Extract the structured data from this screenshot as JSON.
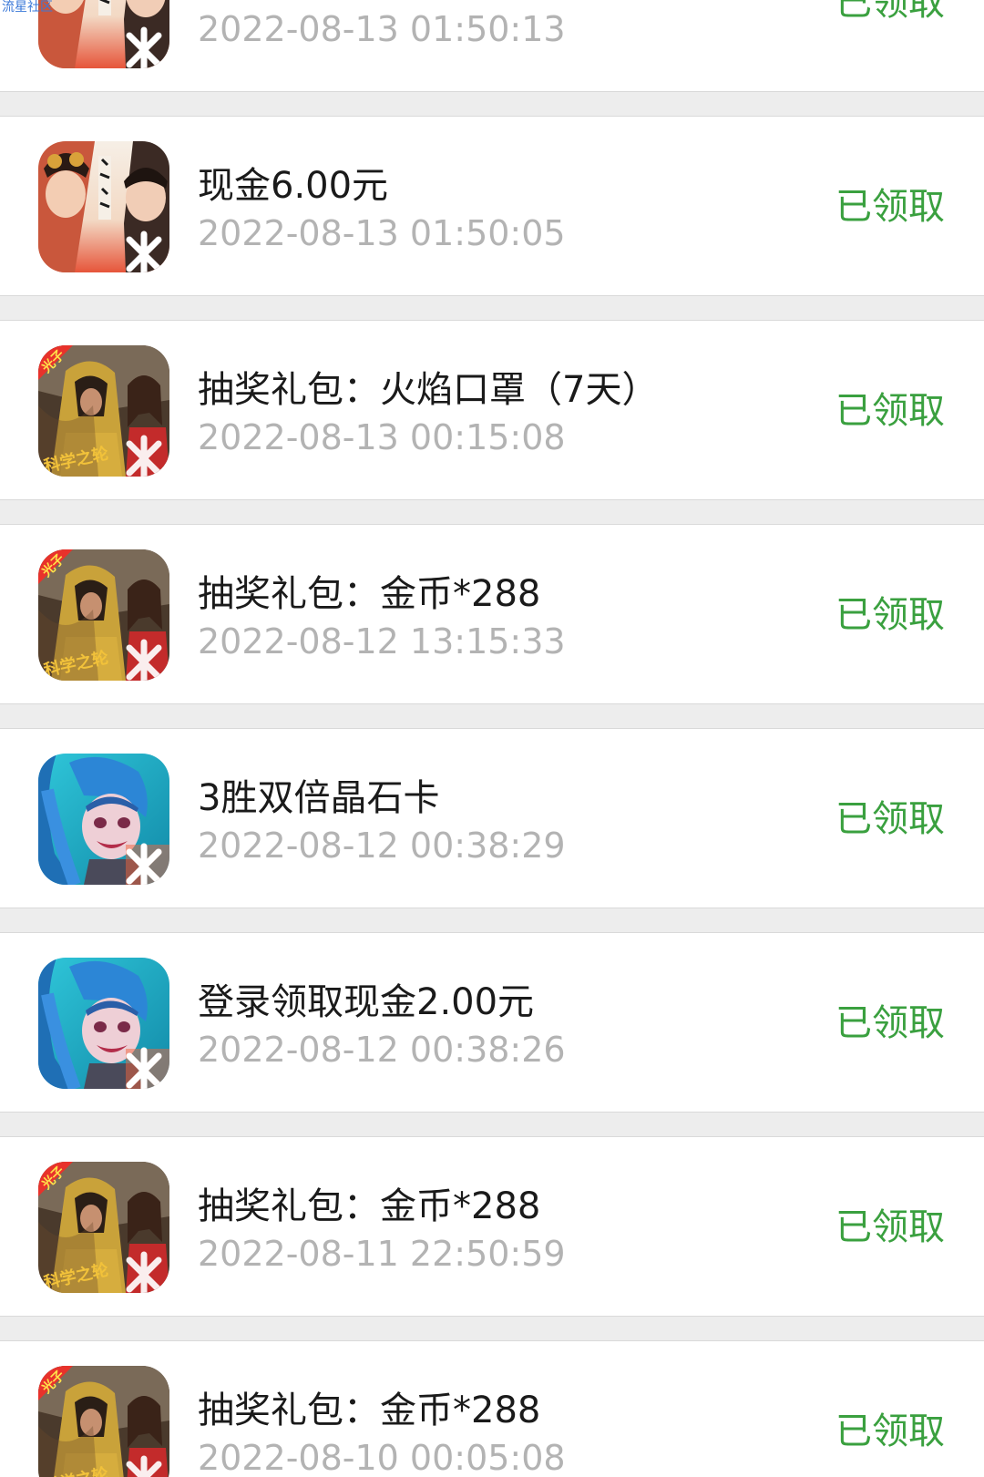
{
  "watermark": "流星社区",
  "records": [
    {
      "title": "",
      "time": "2022-08-13 01:50:13",
      "status": "已领取",
      "game_icon": "drama-game-icon"
    },
    {
      "title": "现金6.00元",
      "time": "2022-08-13 01:50:05",
      "status": "已领取",
      "game_icon": "drama-game-icon"
    },
    {
      "title": "抽奖礼包：火焰口罩（7天）",
      "time": "2022-08-13 00:15:08",
      "status": "已领取",
      "game_icon": "battle-game-icon",
      "icon_badge": "光子",
      "icon_caption": "科学之轮"
    },
    {
      "title": "抽奖礼包：金币*288",
      "time": "2022-08-12 13:15:33",
      "status": "已领取",
      "game_icon": "battle-game-icon",
      "icon_badge": "光子",
      "icon_caption": "科学之轮"
    },
    {
      "title": "3胜双倍晶石卡",
      "time": "2022-08-12 00:38:29",
      "status": "已领取",
      "game_icon": "hero-game-icon"
    },
    {
      "title": "登录领取现金2.00元",
      "time": "2022-08-12 00:38:26",
      "status": "已领取",
      "game_icon": "hero-game-icon"
    },
    {
      "title": "抽奖礼包：金币*288",
      "time": "2022-08-11 22:50:59",
      "status": "已领取",
      "game_icon": "battle-game-icon",
      "icon_badge": "光子",
      "icon_caption": "科学之轮"
    },
    {
      "title": "抽奖礼包：金币*288",
      "time": "2022-08-10 00:05:08",
      "status": "已领取",
      "game_icon": "battle-game-icon",
      "icon_badge": "光子",
      "icon_caption": "科学之轮"
    }
  ],
  "colors": {
    "status_green": "#3aa03f",
    "timestamp_gray": "#b3b3b3",
    "title_black": "#1a1a1a",
    "page_background": "#ededed"
  }
}
